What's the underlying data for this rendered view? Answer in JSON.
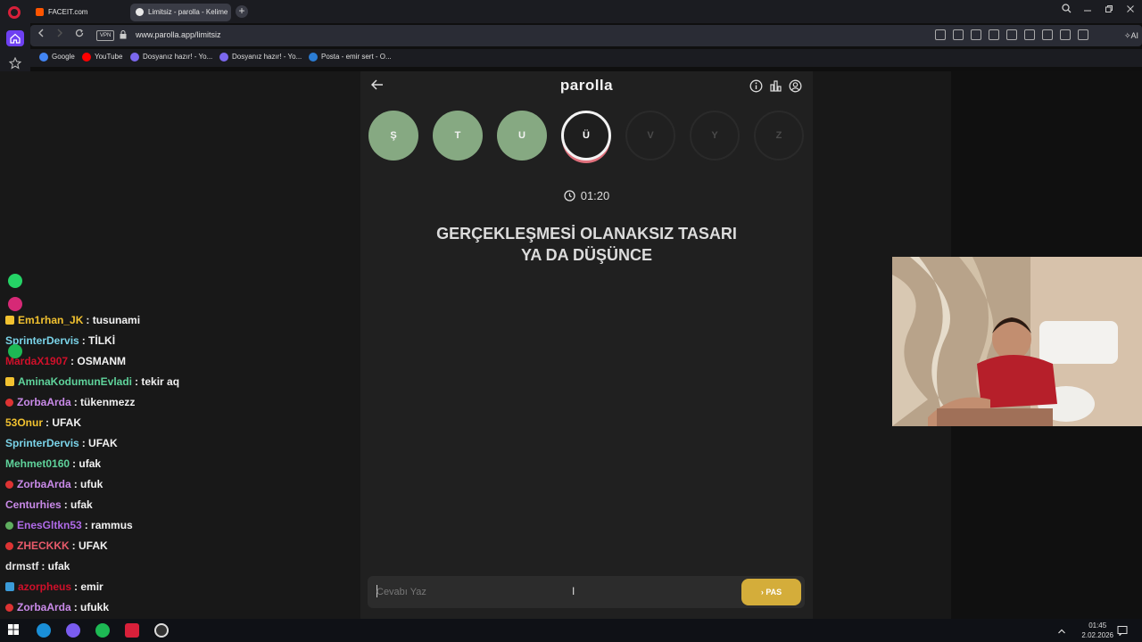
{
  "browser": {
    "tabs": [
      {
        "title": "FACEIT.com"
      },
      {
        "title": "Limitsiz - parolla - Kelime"
      }
    ],
    "new_tab_symbol": "+",
    "vpn_label": "VPN",
    "url": "www.parolla.app/limitsiz",
    "ai_label": "AI",
    "bookmarks": [
      {
        "label": "Google",
        "color": "#4285f4"
      },
      {
        "label": "YouTube",
        "color": "#ff0000"
      },
      {
        "label": "Dosyanız hazır! - Yo...",
        "color": "#7b68ee"
      },
      {
        "label": "Dosyanız hazır! - Yo...",
        "color": "#7b68ee"
      },
      {
        "label": "Posta - emir sert - O...",
        "color": "#2b7cd3"
      }
    ],
    "accent": "#6e40f2"
  },
  "chat": {
    "messages": [
      {
        "badge": "crown",
        "user": "Em1rhan_JK",
        "color": "#f2c230",
        "text": ": tusunami"
      },
      {
        "badge": "",
        "user": "SprinterDervis",
        "color": "#7ad3e8",
        "text": ": TİLKİ"
      },
      {
        "badge": "",
        "user": "MardaX1907",
        "color": "#d0102a",
        "text": ": OSMANM"
      },
      {
        "badge": "crown",
        "user": "AminaKodumunEvladi",
        "color": "#5fd39b",
        "text": ": tekir aq"
      },
      {
        "badge": "red",
        "user": "ZorbaArda",
        "color": "#c98ae8",
        "text": ": tükenmezz"
      },
      {
        "badge": "",
        "user": "53Onur",
        "color": "#f2c230",
        "text": ": UFAK"
      },
      {
        "badge": "",
        "user": "SprinterDervis",
        "color": "#7ad3e8",
        "text": ": UFAK"
      },
      {
        "badge": "",
        "user": "Mehmet0160",
        "color": "#5fd39b",
        "text": ": ufak"
      },
      {
        "badge": "red",
        "user": "ZorbaArda",
        "color": "#c98ae8",
        "text": ": ufuk"
      },
      {
        "badge": "",
        "user": "Centurhies",
        "color": "#c98ae8",
        "text": ": ufak"
      },
      {
        "badge": "green",
        "user": "EnesGltkn53",
        "color": "#b06ae8",
        "text": ": rammus"
      },
      {
        "badge": "red",
        "user": "ZHECKKK",
        "color": "#e85a6a",
        "text": ": UFAK"
      },
      {
        "badge": "",
        "user": "drmstf",
        "color": "#e6e6e6",
        "text": ": ufak"
      },
      {
        "badge": "blue",
        "user": "azorpheus",
        "color": "#d0102a",
        "text": ": emir"
      },
      {
        "badge": "red",
        "user": "ZorbaArda",
        "color": "#c98ae8",
        "text": ": ufukk"
      }
    ]
  },
  "game": {
    "logo": "parolla",
    "letters": [
      {
        "char": "Ş",
        "state": "done"
      },
      {
        "char": "T",
        "state": "done"
      },
      {
        "char": "U",
        "state": "done"
      },
      {
        "char": "Ü",
        "state": "current"
      },
      {
        "char": "V",
        "state": "todo"
      },
      {
        "char": "Y",
        "state": "todo"
      },
      {
        "char": "Z",
        "state": "todo"
      }
    ],
    "timer": "01:20",
    "question_line1": "GERÇEKLEŞMESİ OLANAKSIZ TASARI",
    "question_line2": "YA DA DÜŞÜNCE",
    "answer_placeholder": "Cevabı Yaz",
    "pass_label": "PAS",
    "colors": {
      "done": "#86a982",
      "current_ring": "#e0707c",
      "pass": "#d4ad3a"
    }
  },
  "taskbar": {
    "time": "01:45",
    "date": "2.02.2026"
  }
}
